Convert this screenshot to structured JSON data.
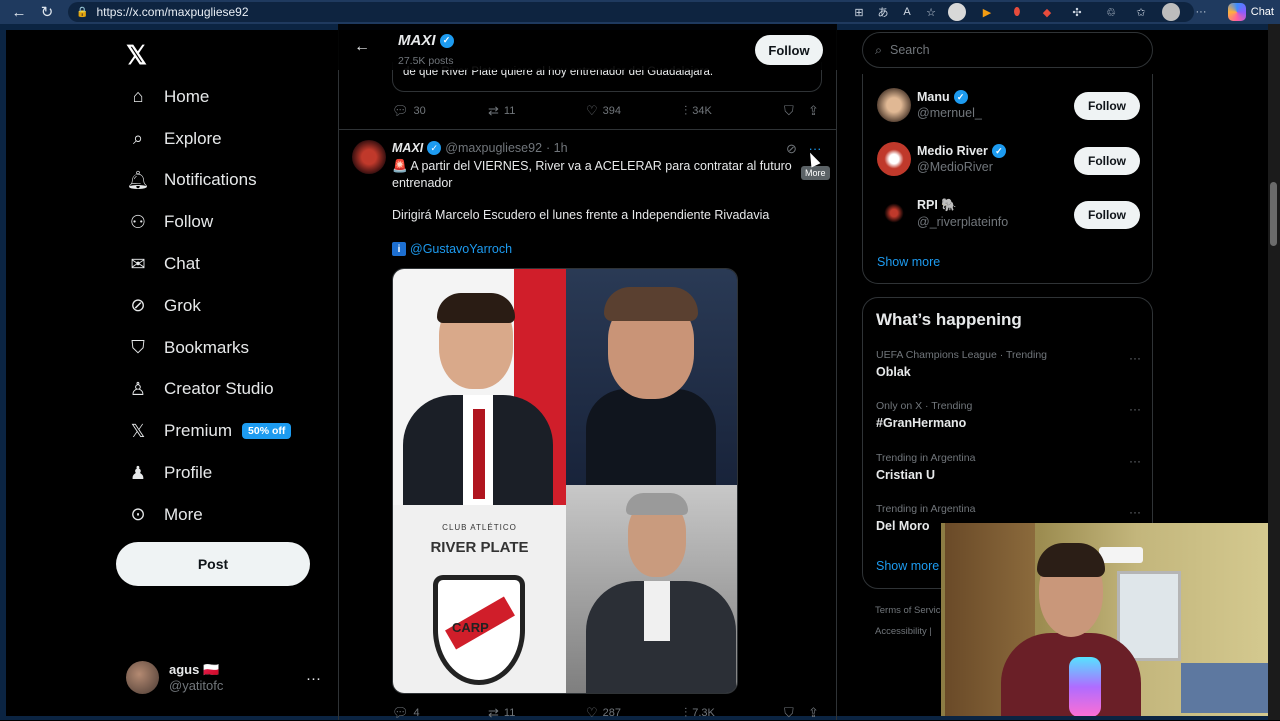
{
  "browser": {
    "url": "https://x.com/maxpugliese92",
    "chat_label": "Chat",
    "icons": [
      "back-icon",
      "refresh-icon",
      "lock-icon"
    ]
  },
  "sidebar": {
    "items": [
      {
        "label": "Home",
        "icon": "home-icon"
      },
      {
        "label": "Explore",
        "icon": "search-icon"
      },
      {
        "label": "Notifications",
        "icon": "bell-icon"
      },
      {
        "label": "Follow",
        "icon": "follow-icon"
      },
      {
        "label": "Chat",
        "icon": "mail-icon"
      },
      {
        "label": "Grok",
        "icon": "grok-icon"
      },
      {
        "label": "Bookmarks",
        "icon": "bookmark-icon"
      },
      {
        "label": "Creator Studio",
        "icon": "creator-icon"
      },
      {
        "label": "Premium",
        "icon": "x-icon"
      },
      {
        "label": "Profile",
        "icon": "person-icon"
      },
      {
        "label": "More",
        "icon": "more-circle-icon"
      }
    ],
    "premium_badge": "50% off",
    "post_label": "Post",
    "account": {
      "name": "agus 🇵🇱",
      "handle": "@yatitofc"
    }
  },
  "profile_header": {
    "name": "MAXI",
    "posts": "27.5K posts",
    "follow_label": "Follow"
  },
  "prev_tweet": {
    "quote_text": "de que River Plate quiere al hoy entrenador del Guadalajara.",
    "replies": "30",
    "reposts": "11",
    "likes": "394",
    "views": "34K"
  },
  "tweet": {
    "name": "MAXI",
    "handle": "@maxpugliese92",
    "time": "· 1h",
    "text": "🚨 A partir del VIERNES, River va a ACELERAR para contratar al futuro entrenador",
    "text2": "Dirigirá Marcelo Escudero el lunes frente a Independiente Rivadavia",
    "mention": "@GustavoYarroch",
    "tooltip": "More",
    "media": {
      "club_small": "CLUB ATLÉTICO",
      "club_big": "RIVER PLATE",
      "crest": "CARP"
    },
    "replies": "4",
    "reposts": "11",
    "likes": "287",
    "views": "7.3K"
  },
  "right": {
    "search_placeholder": "Search",
    "who_to_follow": [
      {
        "name": "Manu",
        "handle": "@mernuel_",
        "verified": true
      },
      {
        "name": "Medio River",
        "handle": "@MedioRiver",
        "verified": true
      },
      {
        "name": "RPI 🐘",
        "handle": "@_riverplateinfo",
        "verified": false
      }
    ],
    "follow_label": "Follow",
    "show_more": "Show more",
    "happening_title": "What’s happening",
    "trends": [
      {
        "context": "UEFA Champions League · Trending",
        "topic": "Oblak"
      },
      {
        "context": "Only on X · Trending",
        "topic": "#GranHermano"
      },
      {
        "context": "Trending in Argentina",
        "topic": "Cristian U"
      },
      {
        "context": "Trending in Argentina",
        "topic": "Del Moro"
      }
    ],
    "show_more2": "Show more",
    "footer1": "Terms of Service",
    "footer2": "Accessibility |"
  },
  "colors": {
    "accent": "#1d9bf0",
    "background": "#000000",
    "border": "#2f3336",
    "muted": "#71767b"
  }
}
